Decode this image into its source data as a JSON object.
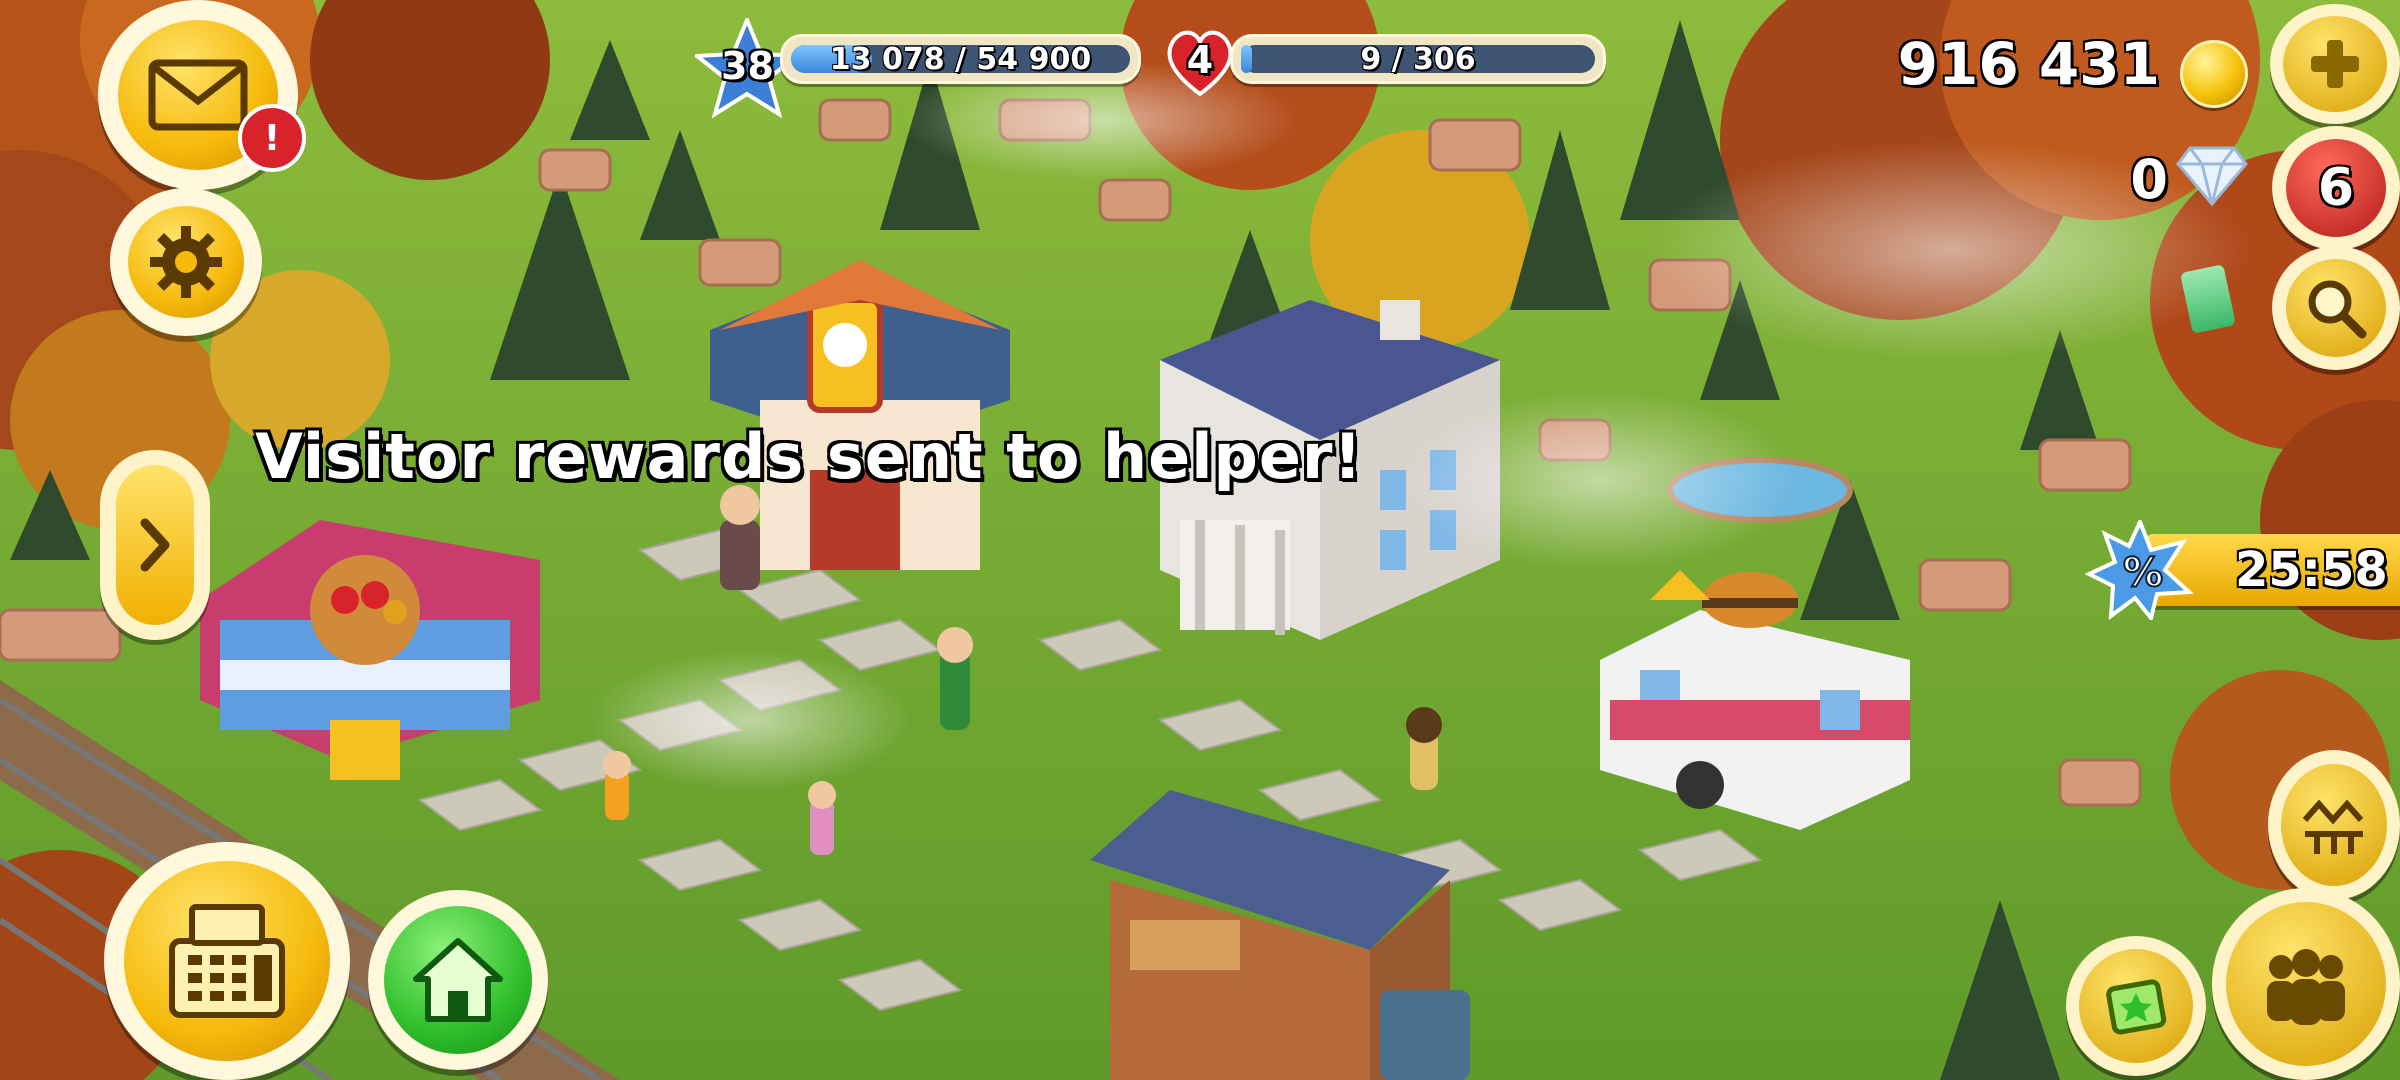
{
  "hud": {
    "level": "38",
    "xp_text": "13 078 / 54 900",
    "xp_progress": 0.238,
    "town_level": "4",
    "population_text": "9 / 306",
    "population_progress": 0.03,
    "coins": "916 431",
    "diamonds": "0",
    "notification_count": "6",
    "mail_alert": "!",
    "sale_timer": "25:58"
  },
  "toast": {
    "message": "Visitor rewards sent to helper!"
  },
  "icons": {
    "mail": "envelope-icon",
    "settings": "gear-icon",
    "expand": "chevron-right-icon",
    "shop": "cash-register-icon",
    "home": "house-icon",
    "coin": "coin-icon",
    "diamond": "diamond-icon",
    "add": "plus-icon",
    "search": "magnifier-icon",
    "sale": "discount-icon",
    "friends": "friends-icon",
    "train": "train-icon",
    "edit": "edit-map-icon"
  },
  "colors": {
    "gold": "#f5b90a",
    "xp_blue": "#3a86d8",
    "red_badge": "#d8232a",
    "green_button": "#2fbf2a"
  }
}
